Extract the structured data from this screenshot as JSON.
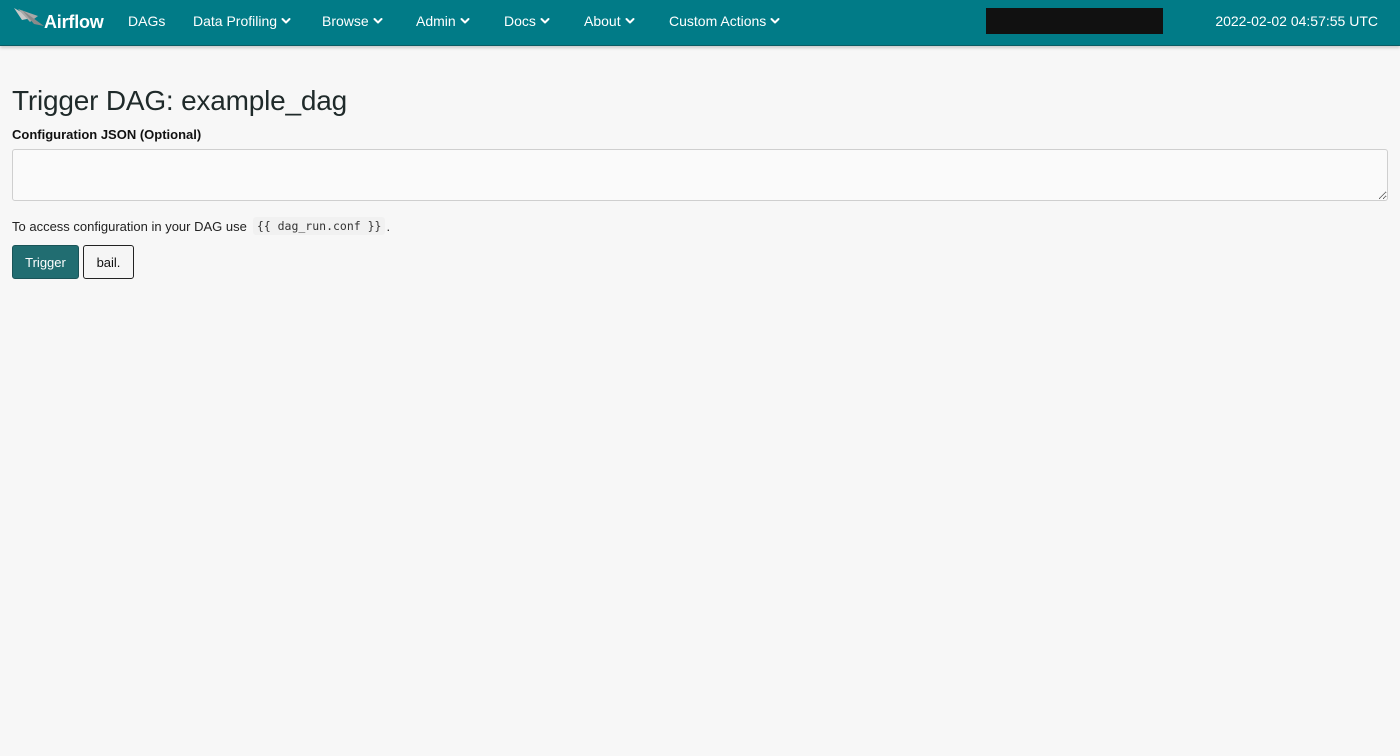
{
  "navbar": {
    "brand": "Airflow",
    "items": [
      {
        "label": "DAGs",
        "dropdown": false
      },
      {
        "label": "Data Profiling",
        "dropdown": true
      },
      {
        "label": "Browse",
        "dropdown": true
      },
      {
        "label": "Admin",
        "dropdown": true
      },
      {
        "label": "Docs",
        "dropdown": true
      },
      {
        "label": "About",
        "dropdown": true
      },
      {
        "label": "Custom Actions",
        "dropdown": true
      }
    ],
    "clock": "2022-02-02 04:57:55 UTC",
    "bg_color": "#017b87"
  },
  "page": {
    "title": "Trigger DAG: example_dag",
    "conf_label": "Configuration JSON (Optional)",
    "conf_value": "",
    "help_prefix": "To access configuration in your DAG use",
    "help_code": "{{ dag_run.conf }}",
    "help_suffix": ".",
    "trigger_label": "Trigger",
    "bail_label": "bail."
  },
  "icons": {
    "brand": "airflow-pinwheel-icon",
    "dropdown": "chevron-down-icon"
  }
}
